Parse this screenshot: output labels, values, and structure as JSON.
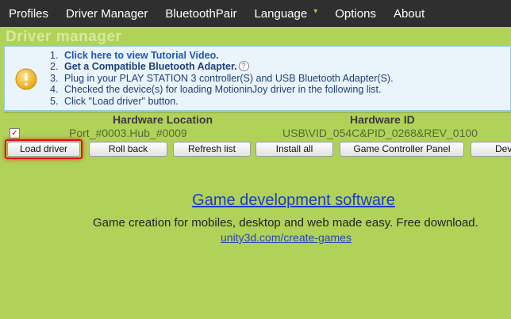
{
  "menu": {
    "items": [
      "Profiles",
      "Driver Manager",
      "BluetoothPair",
      "Language",
      "Options",
      "About"
    ],
    "language_chevron": "chevron-down-icon"
  },
  "page": {
    "title": "Driver manager"
  },
  "info": {
    "icon": "warning-icon",
    "steps": [
      {
        "num": "1.",
        "text": "Click here to view Tutorial Video."
      },
      {
        "num": "2.",
        "text": "Get a Compatible Bluetooth Adapter."
      },
      {
        "num": "3.",
        "text": "Plug in your PLAY STATION 3 controller(S) and USB Bluetooth Adapter(S)."
      },
      {
        "num": "4.",
        "text": "Checked the device(s) for loading MotioninJoy driver in the following list."
      },
      {
        "num": "5.",
        "text": "Click \"Load driver\" button."
      }
    ],
    "help_glyph": "?"
  },
  "table": {
    "headers": {
      "location": "Hardware Location",
      "id": "Hardware ID"
    },
    "rows": [
      {
        "checked": true,
        "check_glyph": "✓",
        "location": "Port_#0003.Hub_#0009",
        "id": "USB\\VID_054C&PID_0268&REV_0100"
      }
    ]
  },
  "toolbar": {
    "load": "Load driver",
    "rollback": "Roll back",
    "refresh": "Refresh list",
    "install": "Install all",
    "panel": "Game Controller Panel",
    "dev": "Dev"
  },
  "ad": {
    "title": "Game development software",
    "description": "Game creation for mobiles, desktop and web made easy. Free download.",
    "link": "unity3d.com/create-games"
  },
  "colors": {
    "background": "#b1d259",
    "menubar": "#2f2f2f",
    "info_bg": "#e9f4fb",
    "highlight": "#e01010"
  }
}
